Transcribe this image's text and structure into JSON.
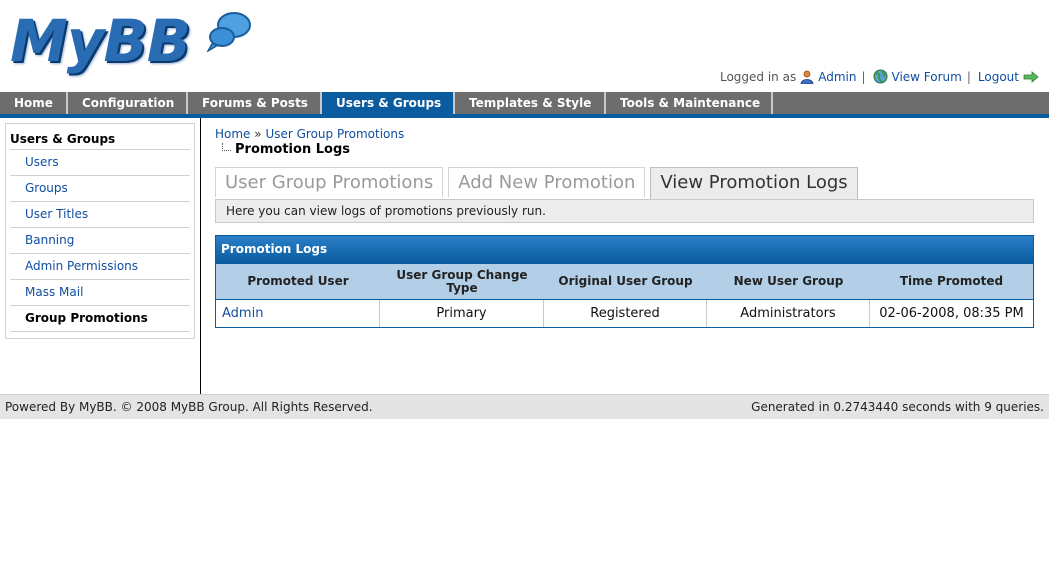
{
  "header": {
    "logo_text": "MyBB",
    "logged_in_prefix": "Logged in as",
    "username": "Admin",
    "view_forum": "View Forum",
    "logout": "Logout",
    "separator": "|"
  },
  "nav": {
    "items": [
      {
        "label": "Home"
      },
      {
        "label": "Configuration"
      },
      {
        "label": "Forums & Posts"
      },
      {
        "label": "Users & Groups"
      },
      {
        "label": "Templates & Style"
      },
      {
        "label": "Tools & Maintenance"
      }
    ],
    "active_index": 3
  },
  "sidebar": {
    "title": "Users & Groups",
    "items": [
      {
        "label": "Users"
      },
      {
        "label": "Groups"
      },
      {
        "label": "User Titles"
      },
      {
        "label": "Banning"
      },
      {
        "label": "Admin Permissions"
      },
      {
        "label": "Mass Mail"
      },
      {
        "label": "Group Promotions"
      }
    ]
  },
  "breadcrumb": {
    "home": "Home",
    "sep": "»",
    "current": "User Group Promotions"
  },
  "page_title": "Promotion Logs",
  "tabs": [
    {
      "label": "User Group Promotions"
    },
    {
      "label": "Add New Promotion"
    },
    {
      "label": "View Promotion Logs"
    }
  ],
  "tab_description": "Here you can view logs of promotions previously run.",
  "table": {
    "title": "Promotion Logs",
    "headers": [
      "Promoted User",
      "User Group Change Type",
      "Original User Group",
      "New User Group",
      "Time Promoted"
    ],
    "rows": [
      [
        "Admin",
        "Primary",
        "Registered",
        "Administrators",
        "02-06-2008, 08:35 PM"
      ]
    ]
  },
  "footer": {
    "left": "Powered By MyBB. © 2008 MyBB Group. All Rights Reserved.",
    "right": "Generated in 0.2743440 seconds with 9 queries."
  },
  "colors": {
    "accent": "#0a5c9f",
    "nav_bg": "#6d6d6d",
    "link": "#0f4e9e",
    "table_header_bg": "#b3cfe7"
  }
}
